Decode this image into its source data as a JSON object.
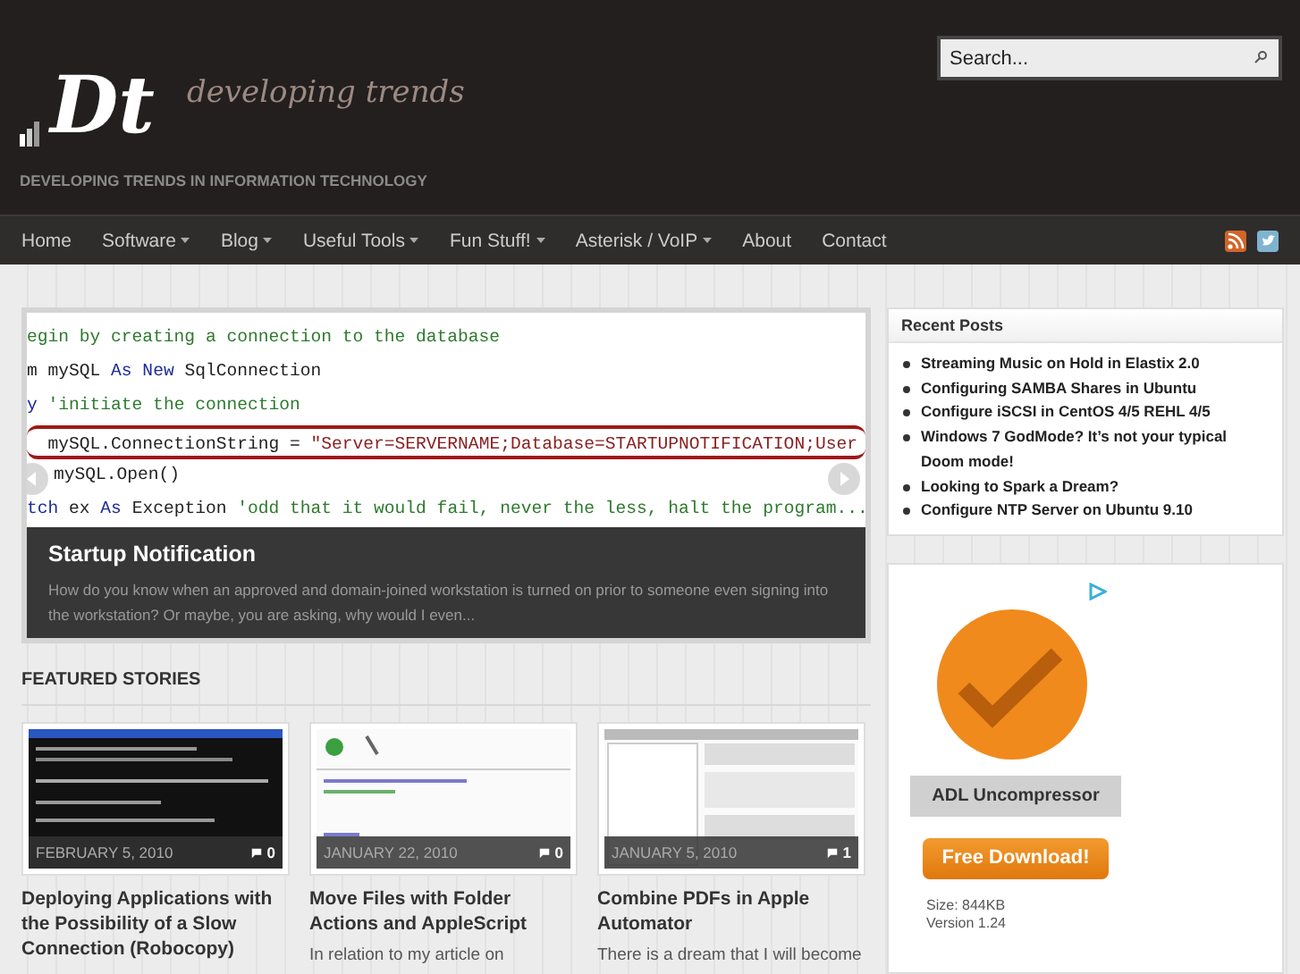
{
  "header": {
    "logo_mark": "Dt",
    "logo_text": "developing trends",
    "tagline": "DEVELOPING TRENDS IN INFORMATION TECHNOLOGY",
    "search": {
      "placeholder": "Search..."
    }
  },
  "nav": [
    {
      "label": "Home",
      "dropdown": false
    },
    {
      "label": "Software",
      "dropdown": true
    },
    {
      "label": "Blog",
      "dropdown": true
    },
    {
      "label": "Useful Tools",
      "dropdown": true
    },
    {
      "label": "Fun Stuff!",
      "dropdown": true
    },
    {
      "label": "Asterisk / VoIP",
      "dropdown": true
    },
    {
      "label": "About",
      "dropdown": false
    },
    {
      "label": "Contact",
      "dropdown": false
    }
  ],
  "slider": {
    "code_lines": [
      {
        "kind": "code",
        "parts": [
          {
            "kind": "comment",
            "text": "egin by creating a connection to the database"
          }
        ]
      },
      {
        "kind": "code",
        "parts": [
          {
            "kind": "plain",
            "text": "m mySQL "
          },
          {
            "kind": "keyword",
            "text": "As New"
          },
          {
            "kind": "plain",
            "text": " SqlConnection"
          }
        ]
      },
      {
        "kind": "code",
        "parts": [
          {
            "kind": "keyword",
            "text": "y"
          },
          {
            "kind": "comment",
            "text": " 'initiate the connection"
          }
        ]
      },
      {
        "kind": "circled",
        "parts": [
          {
            "kind": "plain",
            "text": "  mySQL.ConnectionString = "
          },
          {
            "kind": "string",
            "text": "\"Server=SERVERNAME;Database=STARTUPNOTIFICATION;User"
          }
        ]
      },
      {
        "kind": "indented",
        "parts": [
          {
            "kind": "plain",
            "text": "mySQL.Open()"
          }
        ]
      },
      {
        "kind": "code",
        "parts": [
          {
            "kind": "keyword",
            "text": "tch"
          },
          {
            "kind": "plain",
            "text": " ex "
          },
          {
            "kind": "keyword",
            "text": "As"
          },
          {
            "kind": "plain",
            "text": " Exception "
          },
          {
            "kind": "comment",
            "text": "'odd that it would fail, never the less, halt the program..."
          }
        ]
      }
    ],
    "caption_title": "Startup Notification",
    "caption_text": "How do you know when an approved and domain-joined workstation is turned on prior to someone even signing into the workstation? Or maybe, you are asking, why would I even..."
  },
  "featured": {
    "heading": "FEATURED STORIES",
    "stories": [
      {
        "kind": "console",
        "date": "FEBRUARY 5, 2010",
        "comments": "0",
        "title": "Deploying Applications with the Possibility of a Slow Connection (Robocopy)"
      },
      {
        "kind": "editor",
        "date": "JANUARY 22, 2010",
        "comments": "0",
        "title": "Move Files with Folder Actions and AppleScript",
        "excerpt": "In relation to my article on"
      },
      {
        "kind": "window",
        "date": "JANUARY 5, 2010",
        "comments": "1",
        "title": "Combine PDFs in Apple Automator",
        "excerpt": "There is a dream that I will become"
      }
    ]
  },
  "recent_posts": {
    "title": "Recent Posts",
    "items": [
      "Streaming Music on Hold in Elastix 2.0",
      "Configuring SAMBA Shares in Ubuntu",
      "Configure iSCSI in CentOS 4/5 REHL 4/5",
      "Windows 7 GodMode? It’s not your typical Doom mode!",
      "Looking to Spark a Dream?",
      "Configure NTP Server on Ubuntu 9.10"
    ]
  },
  "ad": {
    "product": "ADL Uncompressor",
    "button": "Free Download!",
    "size": "Size: 844KB",
    "version": "Version 1.24"
  }
}
